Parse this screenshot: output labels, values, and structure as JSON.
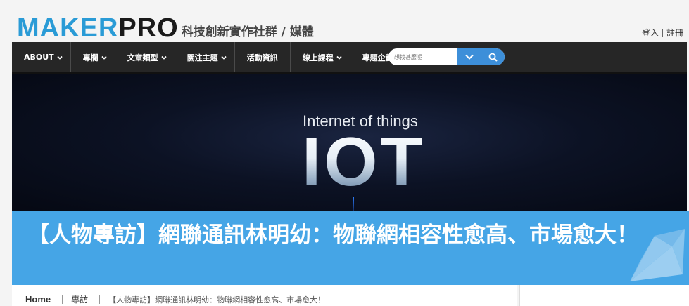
{
  "brand": {
    "logo_part1": "MAKER",
    "logo_part2": "PRO",
    "tagline": "科技創新實作社群 / 媒體"
  },
  "auth": {
    "login": "登入",
    "register": "註冊"
  },
  "nav": {
    "items": [
      {
        "label": "ABOUT",
        "dropdown": true
      },
      {
        "label": "專欄",
        "dropdown": true
      },
      {
        "label": "文章類型",
        "dropdown": true
      },
      {
        "label": "關注主題",
        "dropdown": true
      },
      {
        "label": "活動資訊",
        "dropdown": false
      },
      {
        "label": "線上課程",
        "dropdown": true
      },
      {
        "label": "專題企劃",
        "dropdown": true
      }
    ],
    "search_placeholder": "想找甚麼呢",
    "dropdown_icon": "chevron-down-icon",
    "search_icon": "search-icon"
  },
  "hero": {
    "subtitle": "Internet of things",
    "title": "IOT"
  },
  "article": {
    "title": "【人物專訪】網聯通訊林明幼：物聯網相容性愈高、市場愈大！"
  },
  "breadcrumb": {
    "home": "Home",
    "section": "專訪",
    "current": "【人物專訪】網聯通訊林明幼：物聯網相容性愈高、市場愈大！"
  },
  "colors": {
    "brand_blue": "#2a9bd6",
    "nav_bg": "#262626",
    "banner_blue": "#45a5e6",
    "search_accent": "#3d8fd9"
  }
}
